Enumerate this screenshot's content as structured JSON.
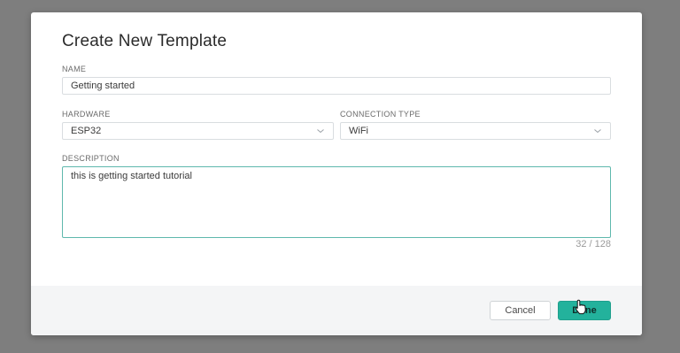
{
  "dialog": {
    "title": "Create New Template",
    "name": {
      "label": "NAME",
      "value": "Getting started"
    },
    "hardware": {
      "label": "HARDWARE",
      "value": "ESP32"
    },
    "connection_type": {
      "label": "CONNECTION TYPE",
      "value": "WiFi"
    },
    "description": {
      "label": "DESCRIPTION",
      "value": "this is getting started tutorial",
      "counter": "32 / 128"
    },
    "footer": {
      "cancel_label": "Cancel",
      "done_label": "Done"
    }
  },
  "colors": {
    "accent": "#23b29c",
    "overlay": "#7e7e7e",
    "focus_border": "#5fb8ad"
  },
  "icons": {
    "select_arrow": "chevron-down-icon",
    "cursor": "hand-pointer-icon"
  }
}
